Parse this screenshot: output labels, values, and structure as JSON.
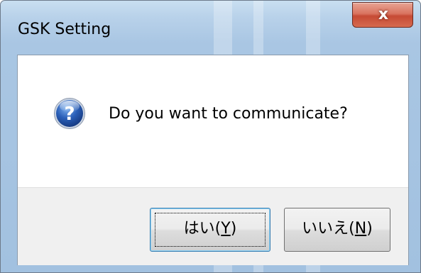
{
  "window": {
    "title": "GSK Setting"
  },
  "titlebar": {
    "close_icon": "close-icon",
    "close_glyph": "x"
  },
  "dialog": {
    "icon": "question-icon",
    "icon_glyph": "?",
    "message": "Do you want to communicate?"
  },
  "buttons": {
    "yes": {
      "label_prefix": "はい(",
      "accel": "Y",
      "label_suffix": ")"
    },
    "no": {
      "label_prefix": "いいえ(",
      "accel": "N",
      "label_suffix": ")"
    }
  },
  "colors": {
    "frame": "#a9c6e3",
    "close_button": "#c64a34",
    "icon_blue": "#2a5fb8",
    "default_button_border": "#3c7fb1"
  }
}
